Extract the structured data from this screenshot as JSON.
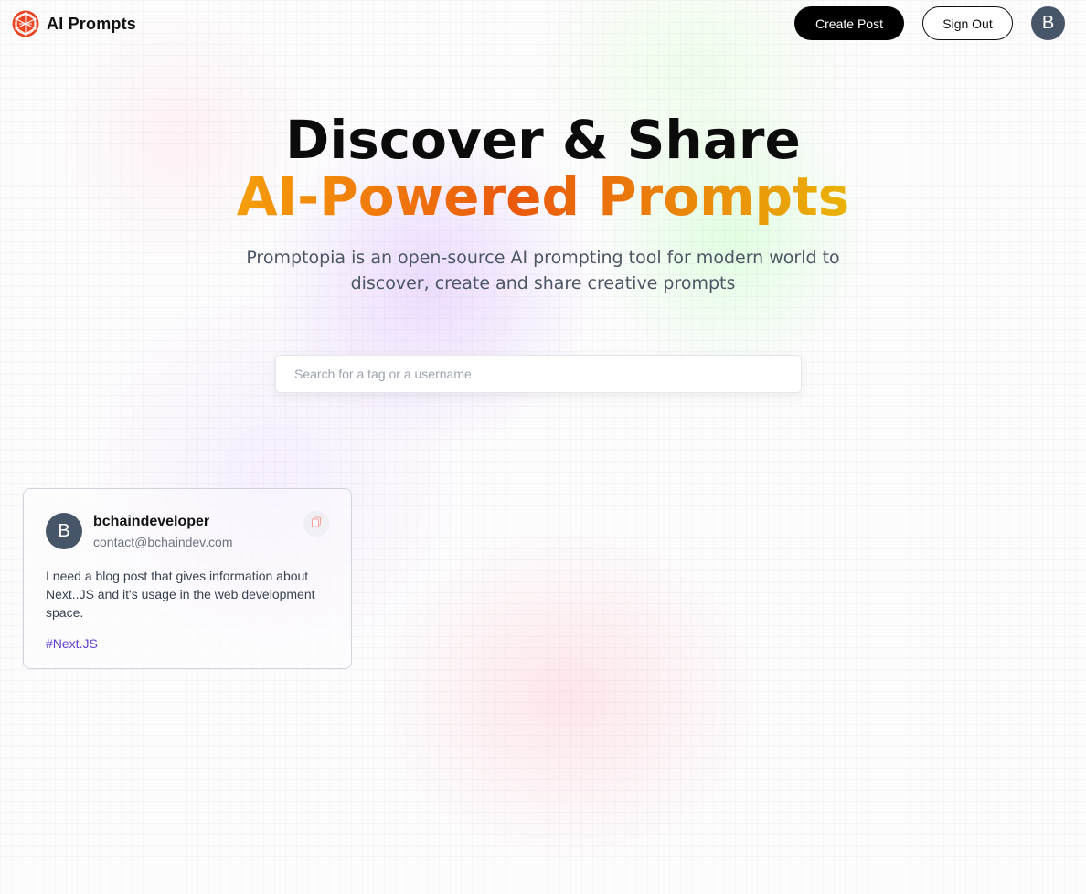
{
  "nav": {
    "brand_name": "AI Prompts",
    "create_post_label": "Create Post",
    "sign_out_label": "Sign Out",
    "avatar_initial": "B",
    "logo_icon": "globe-network-icon"
  },
  "hero": {
    "title_line1": "Discover & Share",
    "title_line2": "AI-Powered Prompts",
    "description": "Promptopia is an open-source AI prompting tool for modern world to discover, create and share creative prompts"
  },
  "search": {
    "placeholder": "Search for a tag or a username",
    "value": ""
  },
  "feed": {
    "cards": [
      {
        "avatar_initial": "B",
        "username": "bchaindeveloper",
        "email": "contact@bchaindev.com",
        "prompt": "I need a blog post that gives information about Next..JS and it's usage in the web development space.",
        "tag": "#Next.JS",
        "copy_icon": "copy-icon"
      }
    ]
  },
  "colors": {
    "accent_orange": "#ea580c",
    "accent_amber": "#f59e0b",
    "tag_purple": "#5b3fd1",
    "avatar_slate": "#475569",
    "button_black": "#000000"
  }
}
